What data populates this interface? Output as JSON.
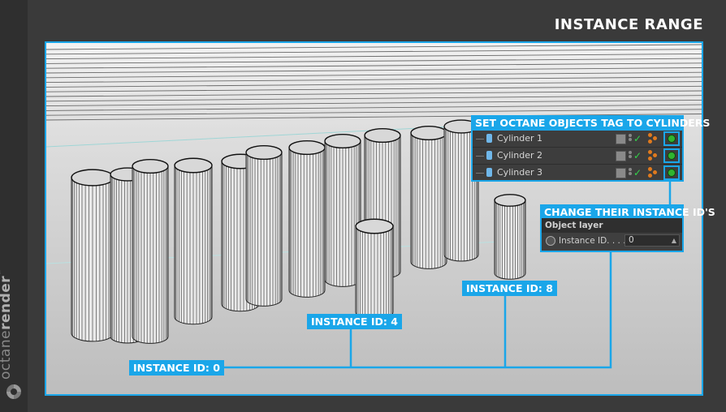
{
  "page": {
    "title": "INSTANCE RANGE"
  },
  "brand": {
    "name_regular": "octane",
    "name_bold": "render",
    "trademark": "™"
  },
  "annotations": {
    "set_tag": "SET OCTANE OBJECTS TAG TO CYLINDERS",
    "change_id": "CHANGE THEIR INSTANCE ID'S",
    "id_0": "INSTANCE ID: 0",
    "id_4": "INSTANCE ID: 4",
    "id_8": "INSTANCE ID: 8"
  },
  "object_manager": {
    "rows": [
      {
        "label": "Cylinder 1"
      },
      {
        "label": "Cylinder 2"
      },
      {
        "label": "Cylinder 3"
      }
    ]
  },
  "object_layer": {
    "header": "Object layer",
    "field_label": "Instance ID. . . .",
    "field_value": "0"
  },
  "colors": {
    "accent": "#1aa6e9",
    "background": "#3a3a3a",
    "tag_green": "#2fb52f"
  }
}
